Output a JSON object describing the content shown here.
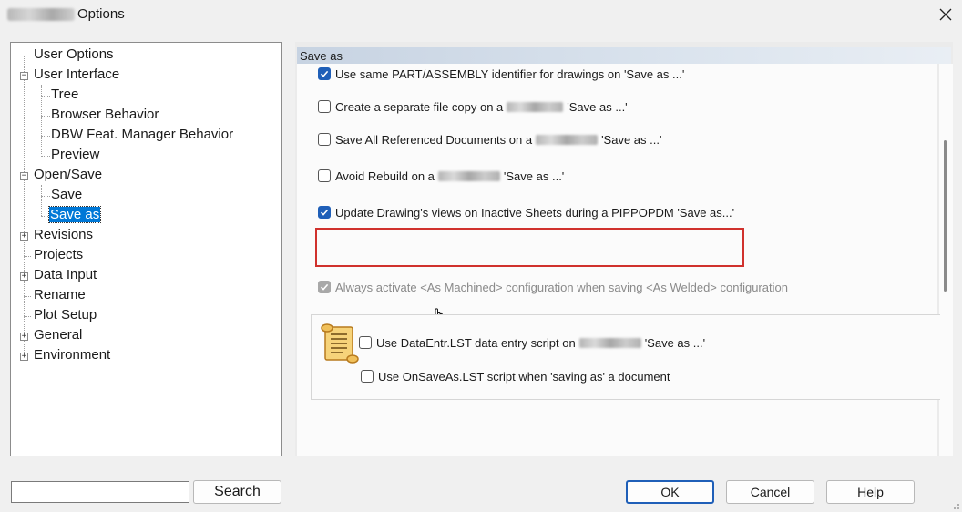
{
  "window": {
    "title": "Options"
  },
  "tree": {
    "items": [
      {
        "label": "User Options"
      },
      {
        "label": "User Interface"
      },
      {
        "label": "Tree"
      },
      {
        "label": "Browser Behavior"
      },
      {
        "label": "DBW Feat. Manager Behavior"
      },
      {
        "label": "Preview"
      },
      {
        "label": "Open/Save"
      },
      {
        "label": "Save"
      },
      {
        "label": "Save as"
      },
      {
        "label": "Revisions"
      },
      {
        "label": "Projects"
      },
      {
        "label": "Data Input"
      },
      {
        "label": "Rename"
      },
      {
        "label": "Plot Setup"
      },
      {
        "label": "General"
      },
      {
        "label": "Environment"
      }
    ],
    "selected": "Save as"
  },
  "panel": {
    "header": "Save as",
    "options": [
      {
        "pre": "Use same PART/ASSEMBLY identifier for drawings on 'Save as ...'",
        "post": "",
        "checked": true
      },
      {
        "pre": "Create a separate file copy on a",
        "post": "'Save as ...'",
        "checked": false
      },
      {
        "pre": "Save All Referenced Documents on a",
        "post": "'Save as ...'",
        "checked": false
      },
      {
        "pre": "Avoid Rebuild on a",
        "post": "'Save as ...'",
        "checked": false
      },
      {
        "pre": "Update Drawing's views on Inactive Sheets during a PIPPOPDM 'Save as...'",
        "post": "",
        "checked": true
      },
      {
        "pre": "Always activate <As Machined> configuration when saving <As Welded> configuration",
        "post": "",
        "checked": true,
        "disabled": true
      }
    ],
    "scripts": [
      {
        "pre": "Use DataEntr.LST data entry script on",
        "post": "'Save as ...'",
        "checked": false
      },
      {
        "pre": "Use OnSaveAs.LST script when 'saving as' a document",
        "post": "",
        "checked": false
      }
    ]
  },
  "footer": {
    "search_value": "",
    "search_label": "Search",
    "ok_label": "OK",
    "cancel_label": "Cancel",
    "help_label": "Help"
  },
  "icons": [
    "close-icon",
    "scroll-script-icon",
    "hand-cursor-icon",
    "resize-grip-icon"
  ],
  "colors": {
    "accent": "#0078d7",
    "checkbox": "#1f5fb8",
    "highlight_box": "#d0312d"
  }
}
